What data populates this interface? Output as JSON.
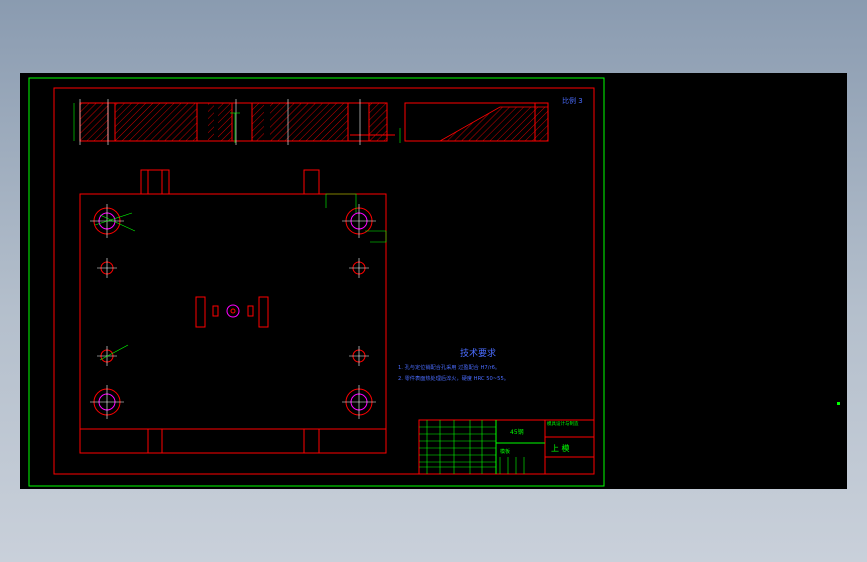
{
  "colors": {
    "background": "#000000",
    "frame": "#00ff00",
    "outline": "#ff0000",
    "hatch": "#ff0000",
    "centerline": "#ffffff",
    "dimension": "#00ff00",
    "holes": "#ff00ff",
    "text": "#4a6cff"
  },
  "drawing": {
    "scale_label": "比例 3",
    "tech_title": "技术要求",
    "tech_notes": [
      "1. 孔与定位销配合孔采用 过盈配合 H7/r6。",
      "2. 零件表面热处理后淬火，硬度 HRC 50~55。"
    ],
    "part_name": "模板",
    "drawing_no": "45钢",
    "company": "模具设计与制造",
    "part_label": "上 模"
  }
}
